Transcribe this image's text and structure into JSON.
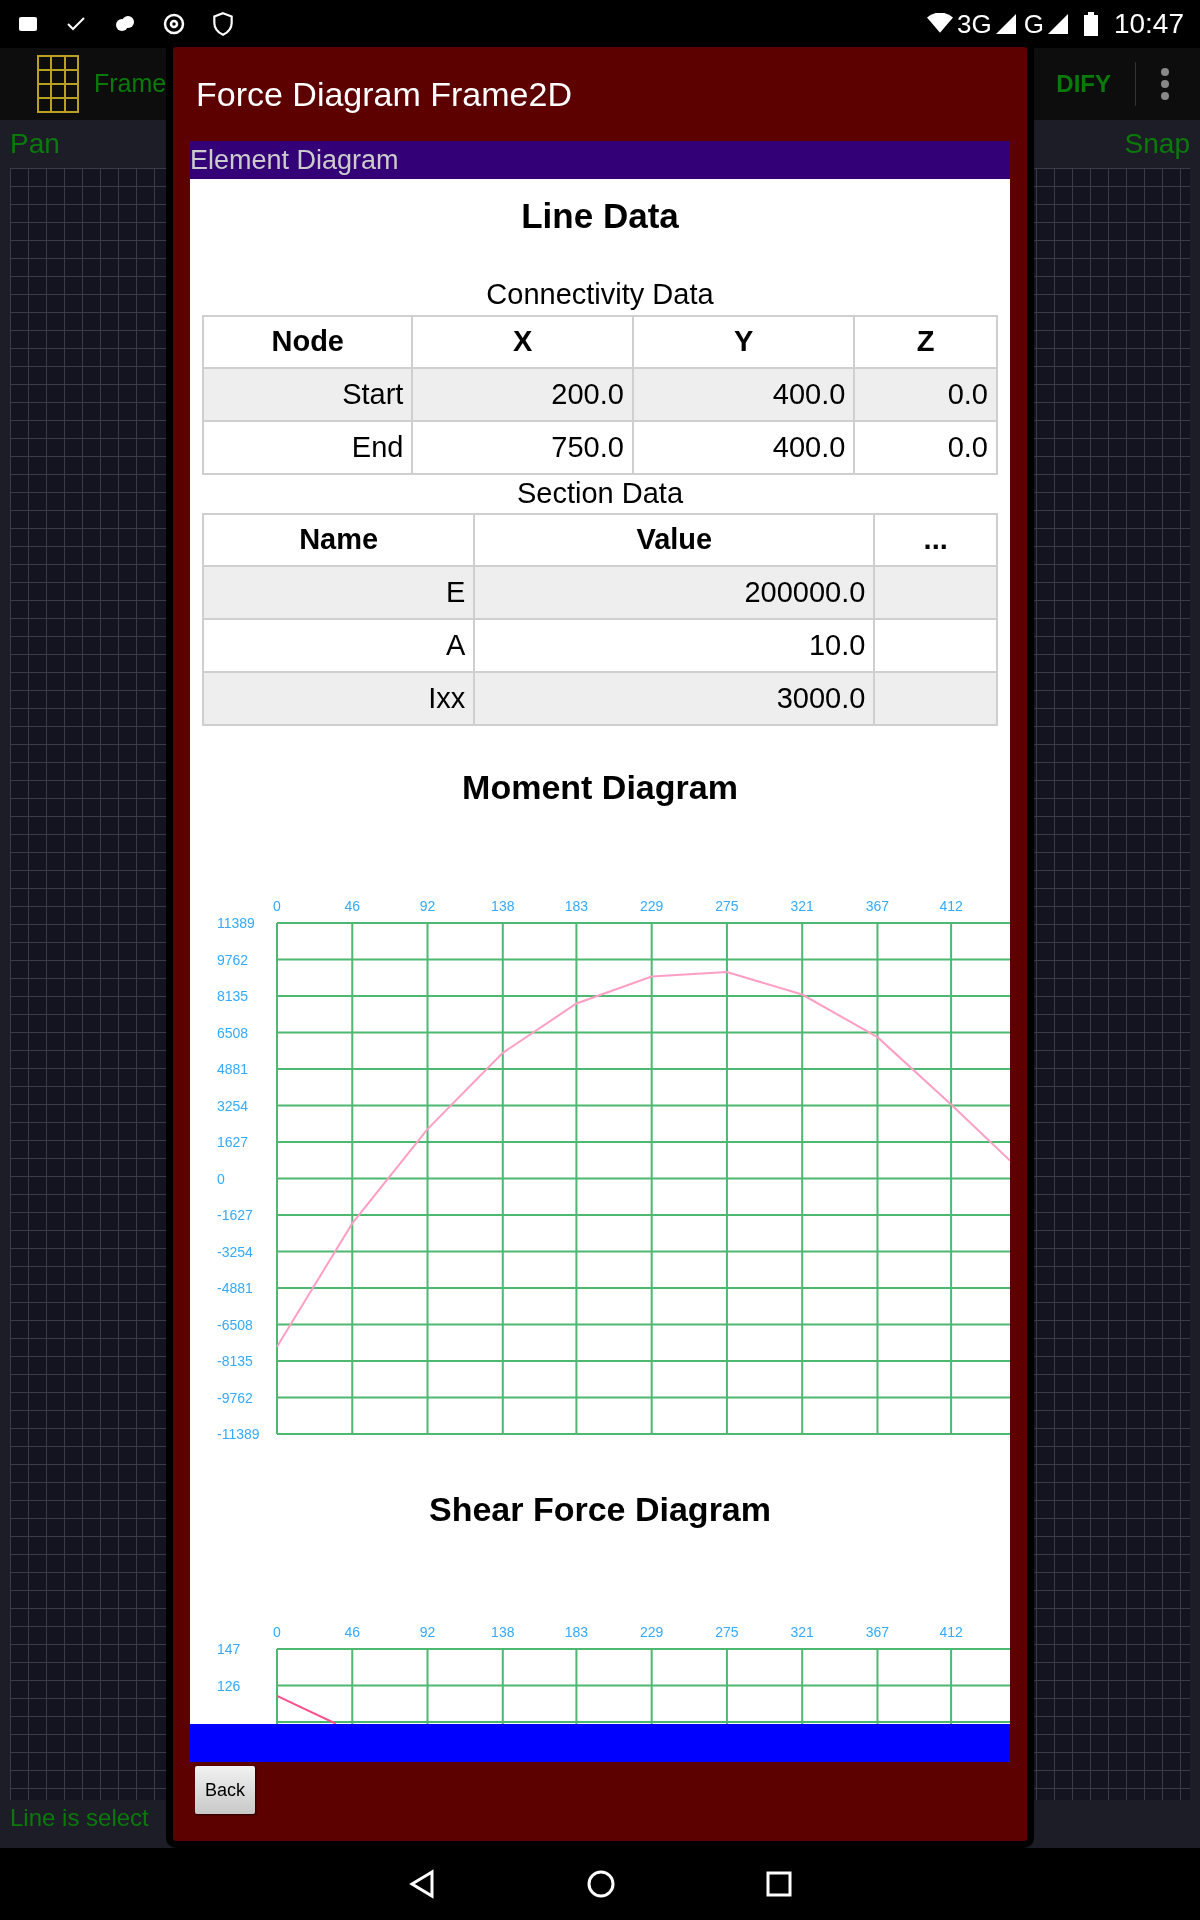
{
  "status_bar": {
    "network": "3G",
    "network_2": "G",
    "time": "10:47"
  },
  "app_bar": {
    "title": "Frame",
    "actions": [
      {
        "label": "DIFY"
      }
    ]
  },
  "canvas": {
    "left_label": "Pan",
    "right_label": "Snap",
    "status": "Line is select"
  },
  "dialog": {
    "title": "Force Diagram Frame2D",
    "header": "Element Diagram",
    "section_title": "Line Data",
    "connectivity": {
      "caption": "Connectivity Data",
      "columns": [
        "Node",
        "X",
        "Y",
        "Z"
      ],
      "rows": [
        [
          "Start",
          "200.0",
          "400.0",
          "0.0"
        ],
        [
          "End",
          "750.0",
          "400.0",
          "0.0"
        ]
      ]
    },
    "section_data": {
      "caption": "Section Data",
      "columns": [
        "Name",
        "Value",
        "..."
      ],
      "rows": [
        [
          "E",
          "200000.0",
          ""
        ],
        [
          "A",
          "10.0",
          ""
        ],
        [
          "Ixx",
          "3000.0",
          ""
        ]
      ]
    },
    "charts": [
      {
        "title": "Moment Diagram",
        "chart_data": {
          "type": "line",
          "grid": true,
          "x": [
            0,
            46,
            92,
            138,
            183,
            229,
            275,
            321,
            367,
            412,
            448
          ],
          "series": [
            {
              "color": "#ff9ec4",
              "values": [
                -7500,
                -2000,
                2200,
                5600,
                7800,
                9000,
                9200,
                8200,
                6300,
                3300,
                800
              ]
            }
          ],
          "xticks": [
            0,
            46,
            92,
            138,
            183,
            229,
            275,
            321,
            367,
            412
          ],
          "xlim": [
            0,
            448
          ],
          "ylim": [
            -11389,
            11389
          ],
          "yticks": [
            11389,
            9762,
            8135,
            6508,
            4881,
            3254,
            1627,
            0,
            -1627,
            -3254,
            -4881,
            -6508,
            -8135,
            -9762,
            -11389
          ]
        }
      },
      {
        "title": "Shear Force Diagram",
        "chart_data": {
          "type": "line",
          "grid": true,
          "x": [
            0,
            36
          ],
          "series": [
            {
              "color": "#ff4f8b",
              "values": [
                120,
                104
              ]
            }
          ],
          "xticks": [
            0,
            46,
            92,
            138,
            183,
            229,
            275,
            321,
            367,
            412
          ],
          "xlim": [
            0,
            448
          ],
          "ylim": [
            -147,
            147
          ],
          "yticks": [
            147,
            126
          ]
        }
      }
    ],
    "back_button": "Back"
  }
}
